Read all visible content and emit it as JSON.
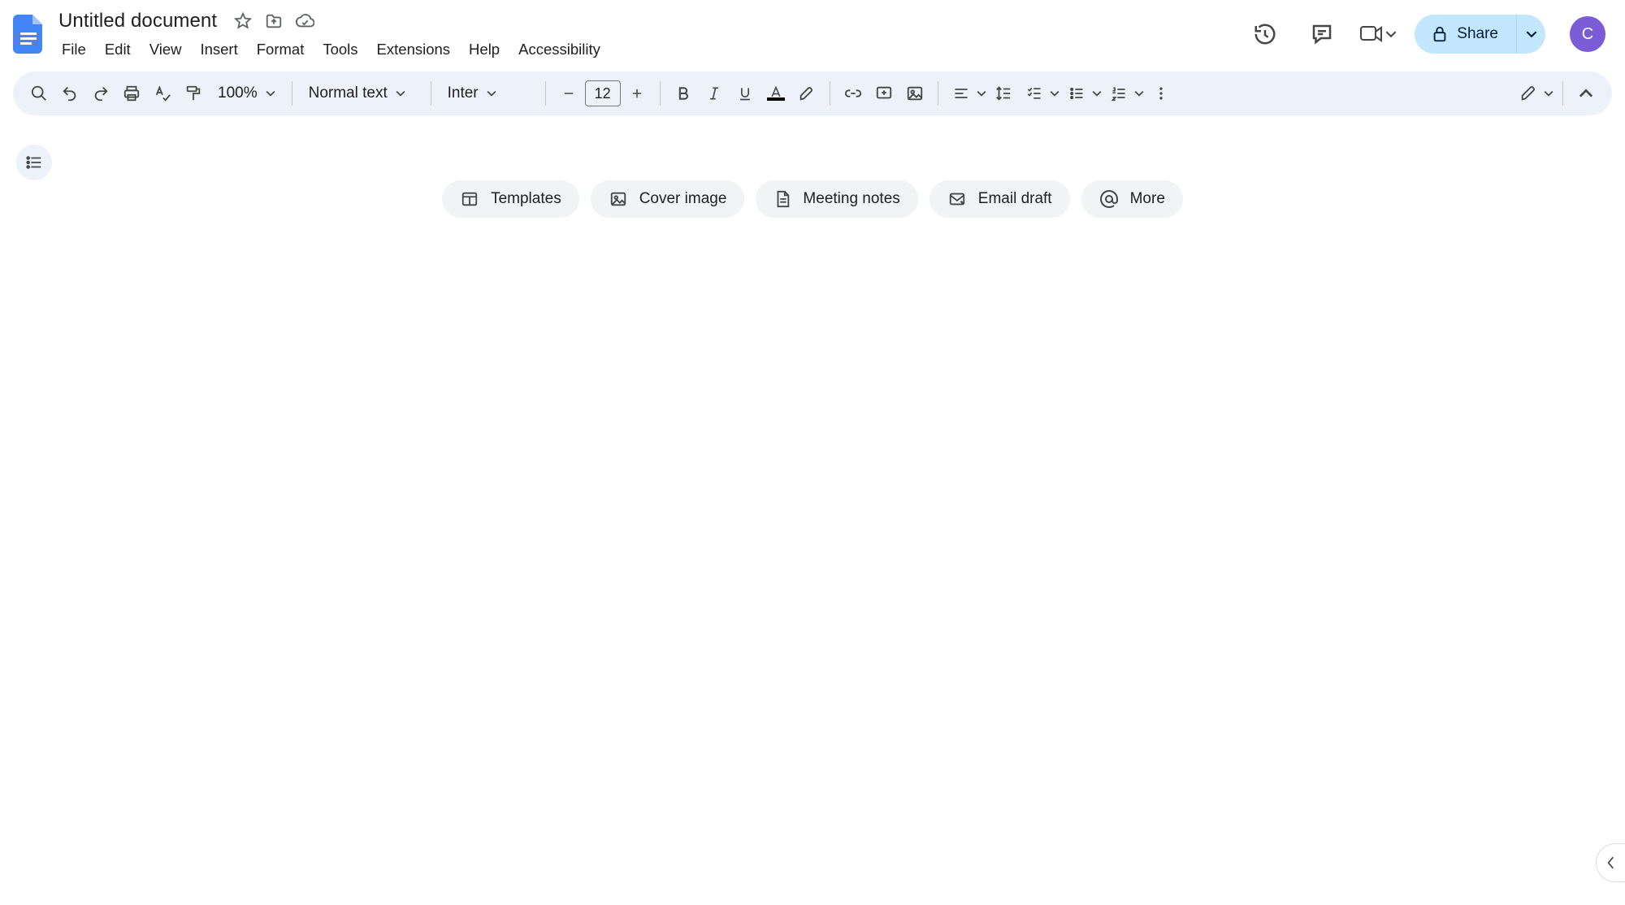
{
  "header": {
    "title": "Untitled document",
    "menus": [
      "File",
      "Edit",
      "View",
      "Insert",
      "Format",
      "Tools",
      "Extensions",
      "Help",
      "Accessibility"
    ],
    "share_label": "Share",
    "avatar_initial": "C"
  },
  "toolbar": {
    "zoom": "100%",
    "style": "Normal text",
    "font": "Inter",
    "font_size": "12"
  },
  "chips": [
    {
      "icon": "templates",
      "label": "Templates"
    },
    {
      "icon": "cover",
      "label": "Cover image"
    },
    {
      "icon": "meeting",
      "label": "Meeting notes"
    },
    {
      "icon": "email",
      "label": "Email draft"
    },
    {
      "icon": "more",
      "label": "More"
    }
  ]
}
